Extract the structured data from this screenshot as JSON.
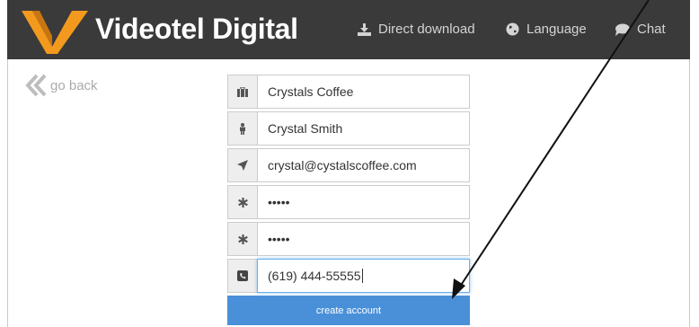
{
  "header": {
    "brand": "Videotel Digital",
    "nav": [
      {
        "label": "Direct download",
        "icon": "download-icon"
      },
      {
        "label": "Language",
        "icon": "globe-icon"
      },
      {
        "label": "Chat",
        "icon": "chat-bubble-icon"
      }
    ],
    "colors": {
      "bar": "#3a3a3a",
      "logo_orange": "#f39a1e"
    }
  },
  "go_back": {
    "label": "go back",
    "icon": "double-chevron-left-icon"
  },
  "form": {
    "fields": [
      {
        "icon": "briefcase-icon",
        "value": "Crystals Coffee"
      },
      {
        "icon": "person-icon",
        "value": "Crystal Smith"
      },
      {
        "icon": "paper-plane-icon",
        "value": "crystal@cystalscoffee.com"
      },
      {
        "icon": "asterisk-icon",
        "value": "•••••"
      },
      {
        "icon": "asterisk-icon",
        "value": "•••••"
      },
      {
        "icon": "phone-square-icon",
        "value": "(619) 444-55555"
      }
    ],
    "submit_label": "create account",
    "colors": {
      "button": "#4a90d9"
    }
  }
}
